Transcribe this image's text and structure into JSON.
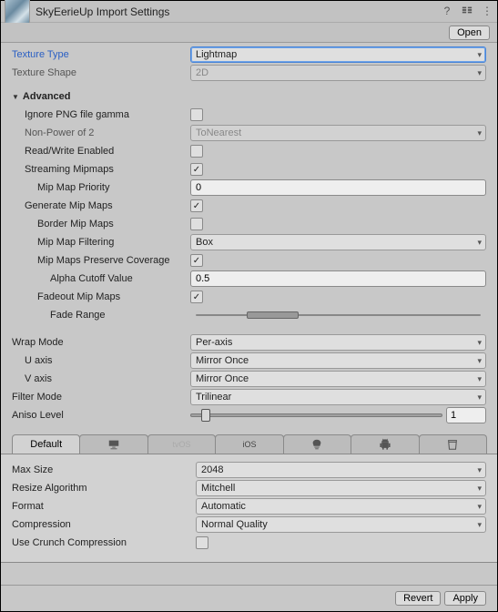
{
  "header": {
    "title": "SkyEerieUp Import Settings",
    "open": "Open"
  },
  "top": {
    "texture_type_label": "Texture Type",
    "texture_type_value": "Lightmap",
    "texture_shape_label": "Texture Shape",
    "texture_shape_value": "2D"
  },
  "adv": {
    "header": "Advanced",
    "ignore_png_label": "Ignore PNG file gamma",
    "ignore_png": false,
    "npot_label": "Non-Power of 2",
    "npot_value": "ToNearest",
    "rw_label": "Read/Write Enabled",
    "rw": false,
    "stream_label": "Streaming Mipmaps",
    "stream": true,
    "mm_priority_label": "Mip Map Priority",
    "mm_priority": "0",
    "gen_mip_label": "Generate Mip Maps",
    "gen_mip": true,
    "border_label": "Border Mip Maps",
    "border": false,
    "mm_filter_label": "Mip Map Filtering",
    "mm_filter_value": "Box",
    "preserve_label": "Mip Maps Preserve Coverage",
    "preserve": true,
    "alpha_cut_label": "Alpha Cutoff Value",
    "alpha_cut": "0.5",
    "fadeout_label": "Fadeout Mip Maps",
    "fadeout": true,
    "fade_range_label": "Fade Range",
    "fade_range_lo": 18,
    "fade_range_hi": 36
  },
  "wrap": {
    "wrap_label": "Wrap Mode",
    "wrap_value": "Per-axis",
    "u_label": "U axis",
    "u_value": "Mirror Once",
    "v_label": "V axis",
    "v_value": "Mirror Once",
    "filter_label": "Filter Mode",
    "filter_value": "Trilinear",
    "aniso_label": "Aniso Level",
    "aniso": "1",
    "aniso_pct": 4
  },
  "tabs": {
    "default": "Default",
    "ios_light": "tvOS",
    "ios": "iOS"
  },
  "platform": {
    "max_size_label": "Max Size",
    "max_size": "2048",
    "resize_label": "Resize Algorithm",
    "resize": "Mitchell",
    "format_label": "Format",
    "format": "Automatic",
    "compression_label": "Compression",
    "compression": "Normal Quality",
    "crunch_label": "Use Crunch Compression",
    "crunch": false
  },
  "footer": {
    "revert": "Revert",
    "apply": "Apply"
  }
}
